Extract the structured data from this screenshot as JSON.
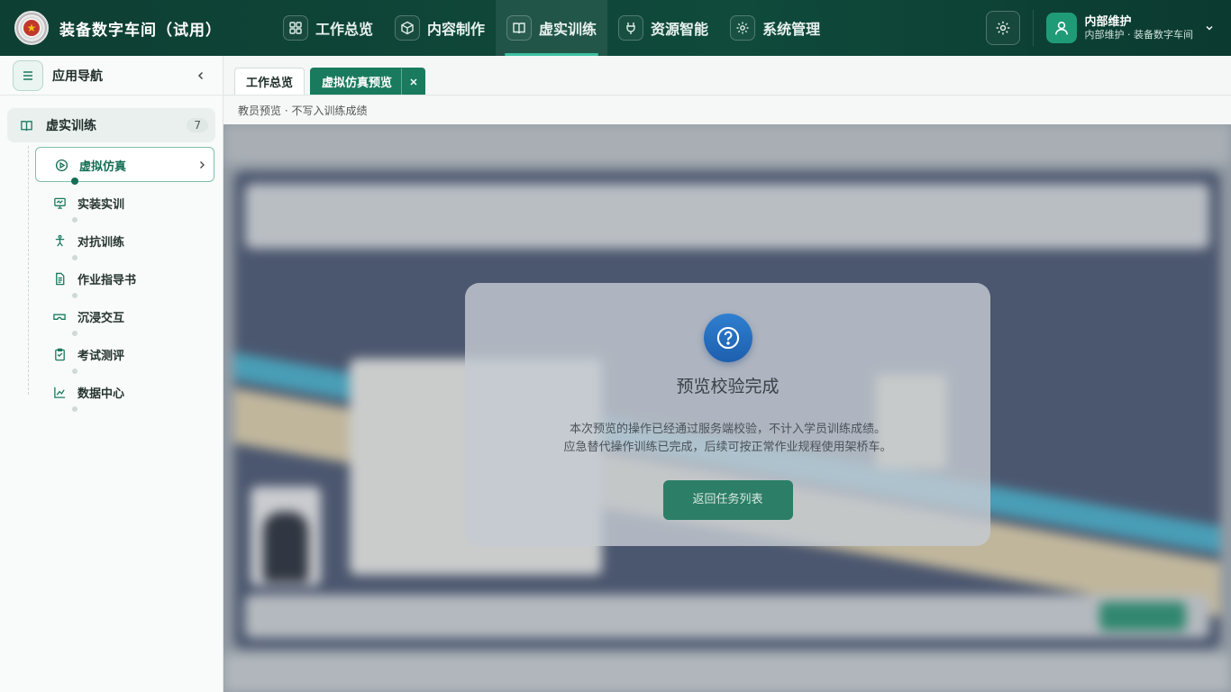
{
  "app": {
    "title": "装备数字车间（试用）"
  },
  "nav": [
    {
      "label": "工作总览",
      "icon": "grid-icon"
    },
    {
      "label": "内容制作",
      "icon": "cube-icon"
    },
    {
      "label": "虚实训练",
      "icon": "book-icon",
      "active": true
    },
    {
      "label": "资源智能",
      "icon": "plug-icon"
    },
    {
      "label": "系统管理",
      "icon": "gear-icon"
    }
  ],
  "user": {
    "name": "内部维护",
    "subtitle": "内部维护 · 装备数字车间"
  },
  "sidebar": {
    "title": "应用导航",
    "group": {
      "label": "虚实训练",
      "count": "7"
    },
    "items": [
      {
        "label": "虚拟仿真",
        "icon": "play-circle-icon",
        "active": true
      },
      {
        "label": "实装实训",
        "icon": "monitor-icon"
      },
      {
        "label": "对抗训练",
        "icon": "figure-icon"
      },
      {
        "label": "作业指导书",
        "icon": "document-icon"
      },
      {
        "label": "沉浸交互",
        "icon": "vr-headset-icon"
      },
      {
        "label": "考试测评",
        "icon": "clipboard-icon"
      },
      {
        "label": "数据中心",
        "icon": "chart-icon"
      }
    ]
  },
  "tabs": [
    {
      "label": "工作总览"
    },
    {
      "label": "虚拟仿真预览",
      "active": true
    }
  ],
  "subnote": "教员预览 · 不写入训练成绩",
  "dialog": {
    "title": "预览校验完成",
    "line1": "本次预览的操作已经通过服务端校验，不计入学员训练成绩。",
    "line2": "应急替代操作训练已完成，后续可按正常作业规程使用架桥车。",
    "button": "返回任务列表"
  },
  "colors": {
    "brand": "#0f4a3b",
    "accent": "#1a7a5e",
    "dialog_icon": "#2f7fd0"
  }
}
